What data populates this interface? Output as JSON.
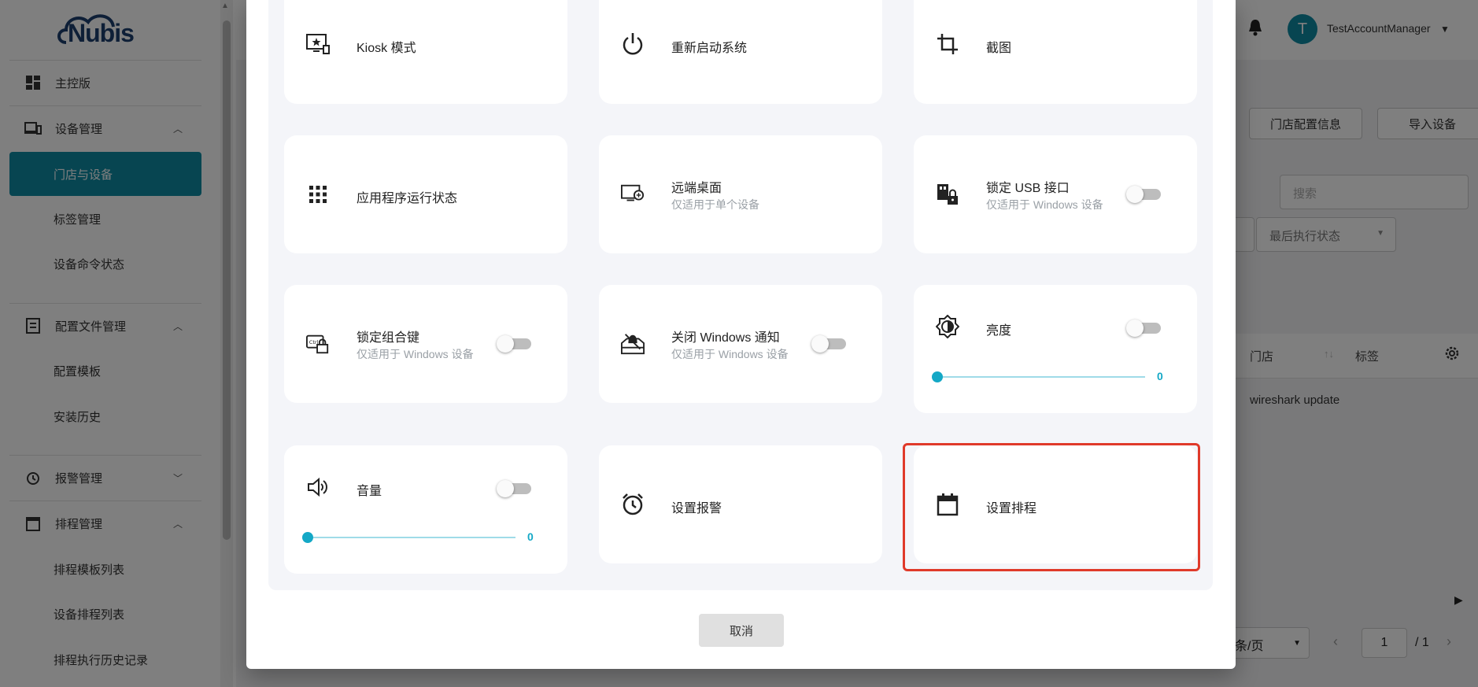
{
  "app": {
    "logo_text": "Nubis"
  },
  "sidebar": {
    "items": [
      {
        "label": "主控版"
      },
      {
        "label": "设备管理"
      },
      {
        "label": "门店与设备"
      },
      {
        "label": "标签管理"
      },
      {
        "label": "设备命令状态"
      },
      {
        "label": "配置文件管理"
      },
      {
        "label": "配置模板"
      },
      {
        "label": "安装历史"
      },
      {
        "label": "报警管理"
      },
      {
        "label": "排程管理"
      },
      {
        "label": "排程模板列表"
      },
      {
        "label": "设备排程列表"
      },
      {
        "label": "排程执行历史记录"
      }
    ]
  },
  "header": {
    "avatar_letter": "T",
    "user_name": "TestAccountManager"
  },
  "toolbar": {
    "store_config_label": "门店配置信息",
    "import_label": "导入设备"
  },
  "filters": {
    "search_placeholder": "搜索",
    "last_status_label": "最后执行状态"
  },
  "table": {
    "columns": [
      "门店",
      "标签"
    ],
    "rows": [
      {
        "cell": "wireshark update"
      }
    ]
  },
  "pagination": {
    "per_page": "条/页",
    "page": "1",
    "total": "/ 1"
  },
  "dialog": {
    "cards": {
      "kiosk": {
        "title": "Kiosk 模式"
      },
      "restart": {
        "title": "重新启动系统"
      },
      "screenshot": {
        "title": "截图"
      },
      "app_status": {
        "title": "应用程序运行状态"
      },
      "remote_desktop": {
        "title": "远端桌面",
        "subtitle": "仅适用于单个设备"
      },
      "lock_usb": {
        "title": "锁定 USB 接口",
        "subtitle": "仅适用于 Windows 设备",
        "enabled": false
      },
      "lock_keys": {
        "title": "锁定组合键",
        "subtitle": "仅适用于 Windows 设备",
        "enabled": false
      },
      "disable_notif": {
        "title": "关闭 Windows 通知",
        "subtitle": "仅适用于 Windows 设备",
        "enabled": false
      },
      "brightness": {
        "title": "亮度",
        "enabled": false,
        "value": "0"
      },
      "volume": {
        "title": "音量",
        "enabled": false,
        "value": "0"
      },
      "set_alarm": {
        "title": "设置报警"
      },
      "set_schedule": {
        "title": "设置排程"
      }
    },
    "cancel_label": "取消"
  },
  "colors": {
    "accent": "#0f8aa3",
    "slider": "#14a8c6",
    "highlight": "#e03a2a"
  }
}
